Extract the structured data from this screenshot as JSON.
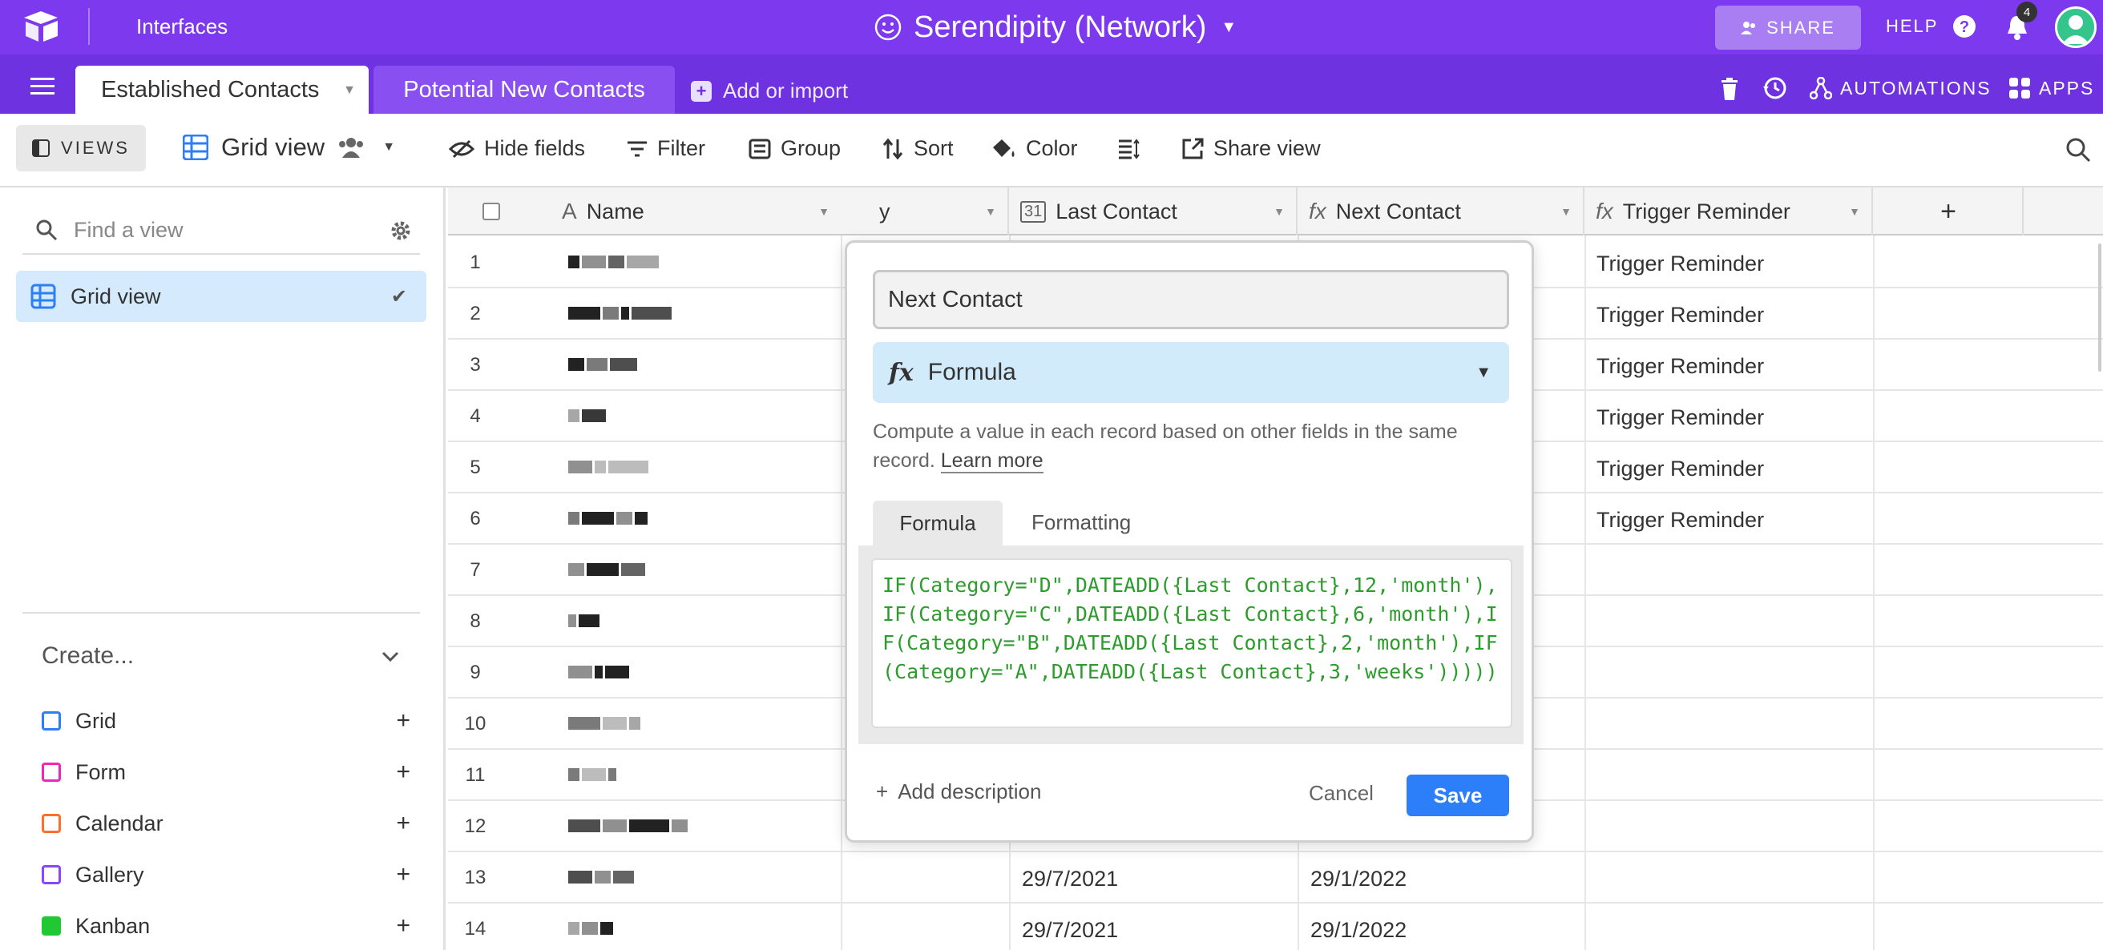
{
  "topbar": {
    "interfaces_label": "Interfaces",
    "base_title": "Serendipity (Network)",
    "share_label": "SHARE",
    "help_label": "HELP",
    "notification_count": "4"
  },
  "tabs": {
    "established": "Established Contacts",
    "potential": "Potential New Contacts",
    "add_import": "Add or import",
    "automations": "AUTOMATIONS",
    "apps": "APPS"
  },
  "toolbar": {
    "views_label": "VIEWS",
    "grid_view_label": "Grid view",
    "hide_fields": "Hide fields",
    "filter": "Filter",
    "group": "Group",
    "sort": "Sort",
    "color": "Color",
    "share_view": "Share view"
  },
  "sidebar": {
    "find_placeholder": "Find a view",
    "active_view": "Grid view",
    "create_label": "Create...",
    "create_items": [
      {
        "label": "Grid",
        "color": "#2d7ff9"
      },
      {
        "label": "Form",
        "color": "#e929ba"
      },
      {
        "label": "Calendar",
        "color": "#ff6f2c"
      },
      {
        "label": "Gallery",
        "color": "#8b46ff"
      },
      {
        "label": "Kanban",
        "color": "#20c933"
      }
    ]
  },
  "grid": {
    "columns": {
      "name": "Name",
      "category_fragment": "y",
      "last_contact": "Last Contact",
      "next_contact": "Next Contact",
      "trigger_reminder": "Trigger Reminder",
      "add_column": "+"
    },
    "rows": [
      {
        "n": "1",
        "last": "",
        "next": "",
        "trigger": "Trigger Reminder"
      },
      {
        "n": "2",
        "last": "",
        "next": "",
        "trigger": "Trigger Reminder"
      },
      {
        "n": "3",
        "last": "",
        "next": "",
        "trigger": "Trigger Reminder"
      },
      {
        "n": "4",
        "last": "",
        "next": "",
        "trigger": "Trigger Reminder"
      },
      {
        "n": "5",
        "last": "",
        "next": "",
        "trigger": "Trigger Reminder"
      },
      {
        "n": "6",
        "last": "",
        "next": "",
        "trigger": "Trigger Reminder"
      },
      {
        "n": "7",
        "last": "",
        "next": "",
        "trigger": ""
      },
      {
        "n": "8",
        "last": "",
        "next": "",
        "trigger": ""
      },
      {
        "n": "9",
        "last": "",
        "next": "",
        "trigger": ""
      },
      {
        "n": "10",
        "last": "",
        "next": "",
        "trigger": ""
      },
      {
        "n": "11",
        "last": "",
        "next": "",
        "trigger": ""
      },
      {
        "n": "12",
        "last": "",
        "next": "",
        "trigger": ""
      },
      {
        "n": "13",
        "last": "29/7/2021",
        "next": "29/1/2022",
        "trigger": ""
      },
      {
        "n": "14",
        "last": "29/7/2021",
        "next": "29/1/2022",
        "trigger": ""
      }
    ]
  },
  "popup": {
    "field_name": "Next Contact",
    "field_type": "Formula",
    "description": "Compute a value in each record based on other fields in the same record.",
    "learn_more": "Learn more",
    "tab_formula": "Formula",
    "tab_formatting": "Formatting",
    "formula": "IF(Category=\"D\",DATEADD({Last Contact},12,'month'),IF(Category=\"C\",DATEADD({Last Contact},6,'month'),IF(Category=\"B\",DATEADD({Last Contact},2,'month'),IF(Category=\"A\",DATEADD({Last Contact},3,'weeks')))))",
    "add_description": "Add description",
    "cancel": "Cancel",
    "save": "Save"
  }
}
